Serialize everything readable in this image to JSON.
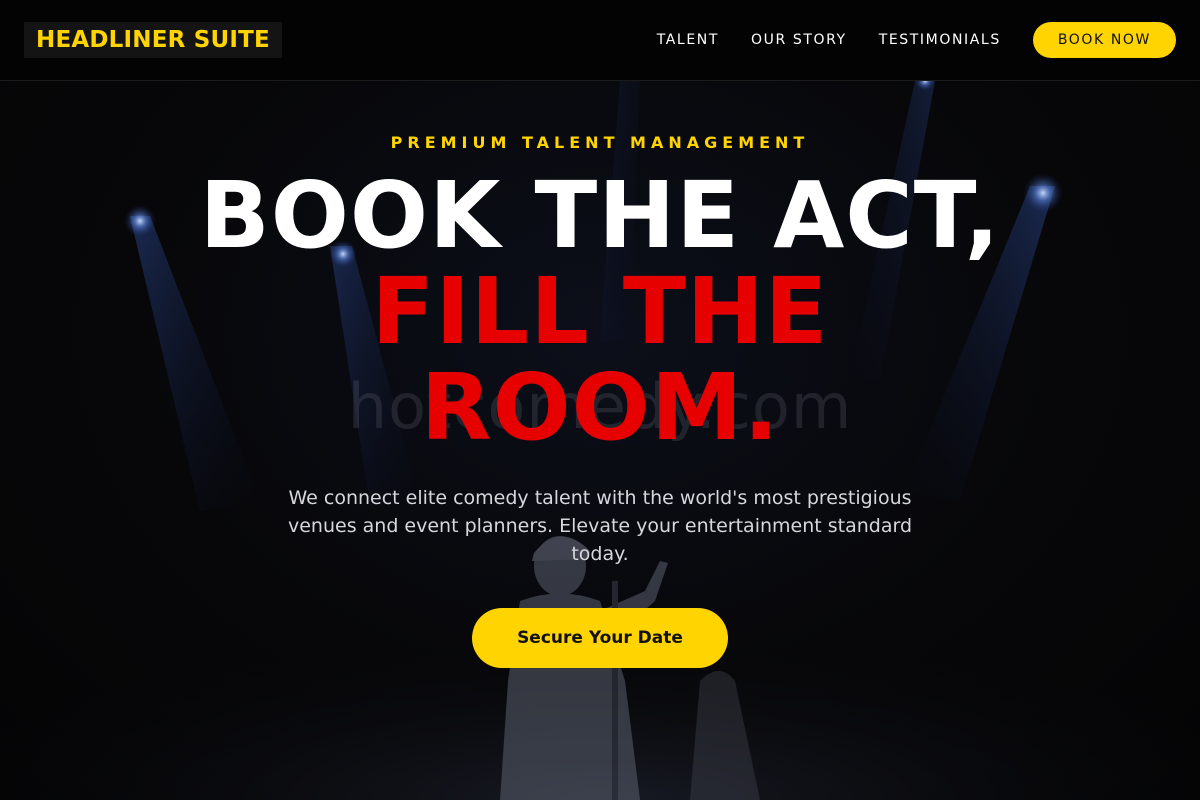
{
  "header": {
    "logo_text": "HEADLINER SUITE",
    "nav": [
      {
        "label": "TALENT"
      },
      {
        "label": "OUR STORY"
      },
      {
        "label": "TESTIMONIALS"
      }
    ],
    "cta_label": "BOOK NOW"
  },
  "hero": {
    "eyebrow": "PREMIUM TALENT MANAGEMENT",
    "headline_line1": "BOOK THE ACT,",
    "headline_line2": "FILL THE",
    "headline_line3": "ROOM.",
    "watermark": "hotcomedy.com",
    "description": "We connect elite comedy talent with the world's most prestigious venues and event planners. Elevate your entertainment standard today.",
    "cta_label": "Secure Your Date"
  },
  "colors": {
    "accent_yellow": "#ffd400",
    "accent_red": "#e60000",
    "background": "#060608"
  }
}
